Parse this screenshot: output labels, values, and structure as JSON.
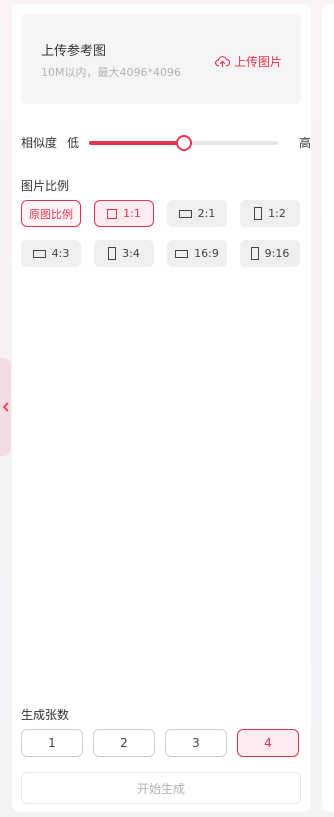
{
  "upload": {
    "title": "上传参考图",
    "hint": "10M以内，最大4096*4096",
    "button_label": "上传图片",
    "button_icon": "cloud-upload-icon"
  },
  "similarity": {
    "label": "相似度",
    "low_label": "低",
    "high_label": "高",
    "value": 0.5
  },
  "ratio": {
    "label": "图片比例",
    "options": [
      {
        "label": "原图比例",
        "shape": "none",
        "state": "selected-text"
      },
      {
        "label": "1:1",
        "shape": "square",
        "state": "selected"
      },
      {
        "label": "2:1",
        "shape": "wide",
        "state": "normal"
      },
      {
        "label": "1:2",
        "shape": "tall",
        "state": "normal"
      },
      {
        "label": "4:3",
        "shape": "wide",
        "state": "normal"
      },
      {
        "label": "3:4",
        "shape": "tall",
        "state": "normal"
      },
      {
        "label": "16:9",
        "shape": "wide",
        "state": "normal"
      },
      {
        "label": "9:16",
        "shape": "tall",
        "state": "normal"
      }
    ]
  },
  "count": {
    "label": "生成张数",
    "options": [
      "1",
      "2",
      "3",
      "4"
    ],
    "selected": "4"
  },
  "generate_label": "开始生成",
  "colors": {
    "accent": "#e8334f",
    "panel": "#ffffff",
    "muted_text": "#b3b3b3"
  }
}
